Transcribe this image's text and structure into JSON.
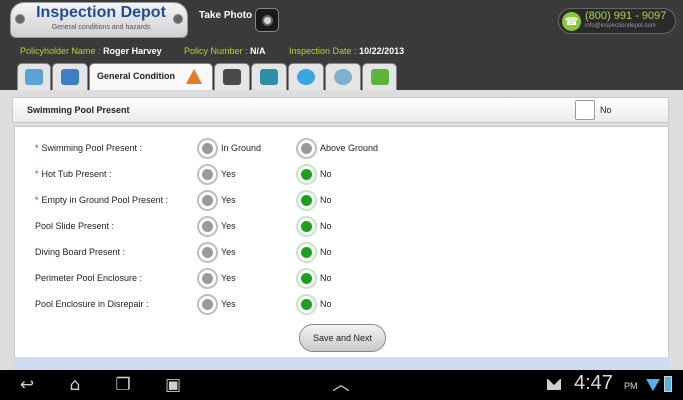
{
  "header": {
    "logo_title": "Inspection Depot",
    "logo_subtitle": "General conditions and hazards",
    "take_photo_label": "Take Photo",
    "phone": "(800) 991 - 9097",
    "email": "info@inspectiondepot.com"
  },
  "info": {
    "policyholder_key": "Policyholder Name :",
    "policyholder_val": "Roger Harvey",
    "policy_number_key": "Policy Number :",
    "policy_number_val": "N/A",
    "inspection_date_key": "Inspection Date :",
    "inspection_date_val": "10/22/2013"
  },
  "tabs": {
    "active_label": "General Condition",
    "icons": [
      "person-icon",
      "building-icon",
      "warning-icon",
      "graduation-cap-icon",
      "picture-icon",
      "speech-bubble-icon",
      "globe-icon",
      "forward-arrow-icon"
    ]
  },
  "section": {
    "title": "Swimming Pool Present",
    "checkbox_label": "No"
  },
  "questions": [
    {
      "label": "Swimming Pool Present :",
      "required": "*",
      "opt1": "In Ground",
      "opt2": "Above Ground",
      "selected": "none"
    },
    {
      "label": "Hot Tub Present :",
      "required": "*",
      "opt1": "Yes",
      "opt2": "No",
      "selected": "No"
    },
    {
      "label": "Empty in Ground Pool Present :",
      "required": "*",
      "opt1": "Yes",
      "opt2": "No",
      "selected": "No"
    },
    {
      "label": "Pool Slide Present :",
      "required": "",
      "opt1": "Yes",
      "opt2": "No",
      "selected": "No"
    },
    {
      "label": "Diving Board Present :",
      "required": "",
      "opt1": "Yes",
      "opt2": "No",
      "selected": "No"
    },
    {
      "label": "Perimeter Pool Enclosure :",
      "required": "",
      "opt1": "Yes",
      "opt2": "No",
      "selected": "No"
    },
    {
      "label": "Pool Enclosure in Disrepair :",
      "required": "",
      "opt1": "Yes",
      "opt2": "No",
      "selected": "No"
    }
  ],
  "save_button": "Save and Next",
  "system_bar": {
    "time": "4:47",
    "ampm": "PM"
  },
  "colors": {
    "brand_blue": "#1e4d9a",
    "accent_green": "#b6d327",
    "radio_selected": "#1aa31a",
    "required_red": "#d92a2a"
  }
}
